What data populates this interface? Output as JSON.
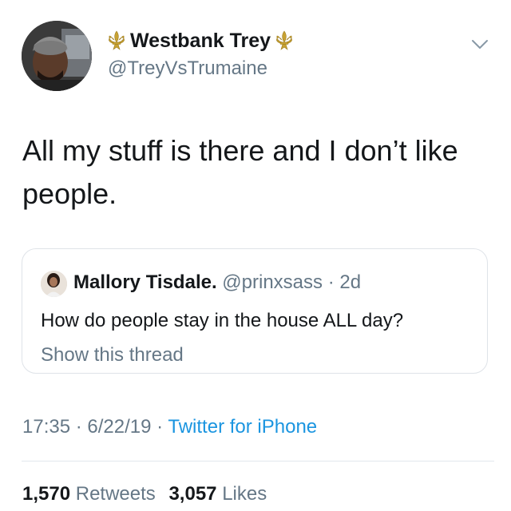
{
  "author": {
    "display_name": "Westbank Trey",
    "handle": "@TreyVsTrumaine",
    "avatar_icon": "profile-photo",
    "name_emoji_icon": "fleur-de-lis-icon"
  },
  "tweet": {
    "text_line1": "All my stuff is there and I don’t like",
    "text_line2": "people."
  },
  "quoted_tweet": {
    "display_name": "Mallory Tisdale.",
    "handle": "@prinxsass",
    "separator": "·",
    "time_ago": "2d",
    "text": "How do people stay in the house ALL day?",
    "show_thread": "Show this thread"
  },
  "meta": {
    "time": "17:35",
    "separator1": "·",
    "date": "6/22/19",
    "separator2": "·",
    "source": "Twitter for iPhone"
  },
  "stats": {
    "retweets_count": "1,570",
    "retweets_label": "Retweets",
    "likes_count": "3,057",
    "likes_label": "Likes"
  },
  "colors": {
    "text_primary": "#14171a",
    "text_secondary": "#657786",
    "link": "#1b95e0",
    "fleur_gold": "#c8a233",
    "border": "#dfe3e8"
  }
}
